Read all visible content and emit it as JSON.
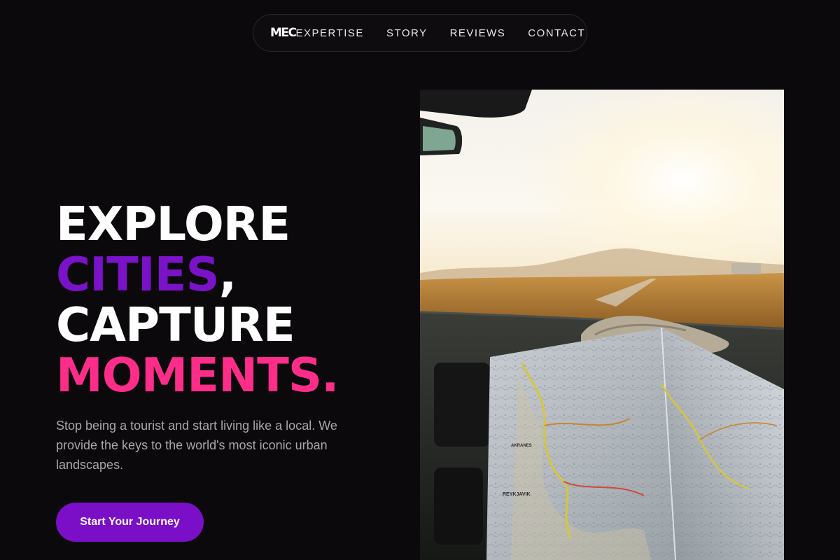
{
  "nav": {
    "logo": "MEC",
    "links": [
      "EXPERTISE",
      "STORY",
      "REVIEWS",
      "CONTACT"
    ]
  },
  "hero": {
    "headline": {
      "line1": "EXPLORE",
      "line2_highlight": "CITIES",
      "line2_rest": ",",
      "line3": "CAPTURE",
      "line4": "MOMENTS."
    },
    "subtitle": "Stop being a tourist and start living like a local. We provide the keys to the world's most iconic urban landscapes.",
    "cta_label": "Start Your Journey",
    "image_map_labels": [
      "REYKJAVIK",
      "AKRANES"
    ]
  },
  "colors": {
    "background": "#0b090b",
    "accent_purple": "#7a12c8",
    "accent_pink": "#ff2d8a",
    "button": "#7a0fc7",
    "text_muted": "#a9a6ad"
  }
}
